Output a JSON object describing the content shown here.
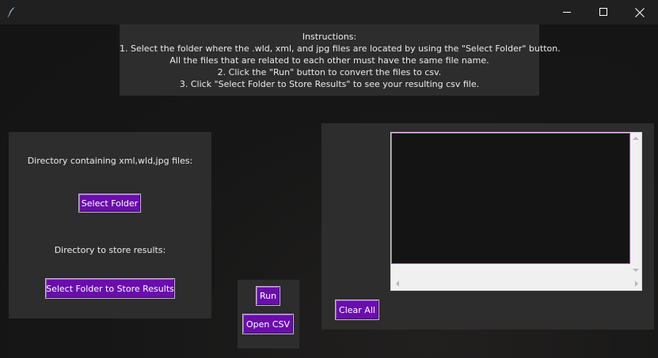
{
  "window": {
    "icon": "feather-icon",
    "controls": {
      "minimize": "minimize-icon",
      "maximize": "maximize-icon",
      "close": "close-icon"
    }
  },
  "instructions": {
    "heading": "Instructions:",
    "lines": [
      "1. Select the folder where the .wld, xml, and jpg files are located by using the \"Select Folder\" button.",
      "All the files that are related to each other must have the same file name.",
      "2. Click the \"Run\" button to convert the files to csv.",
      "3. Click \"Select Folder to Store Results\" to see your resulting csv file."
    ]
  },
  "input_panel": {
    "input_label": "Directory containing xml,wld,jpg files:",
    "select_folder_label": "Select Folder",
    "output_label": "Directory to store results:",
    "select_output_label": "Select Folder to Store Results"
  },
  "actions": {
    "run_label": "Run",
    "open_csv_label": "Open CSV"
  },
  "output_panel": {
    "text_content": "",
    "clear_all_label": "Clear All"
  },
  "colors": {
    "button_bg": "#6a0dad",
    "panel_bg": "#2d2d2d",
    "window_bg": "#161616",
    "text_area_bg": "#141414",
    "text_area_border": "#b04fb0"
  }
}
